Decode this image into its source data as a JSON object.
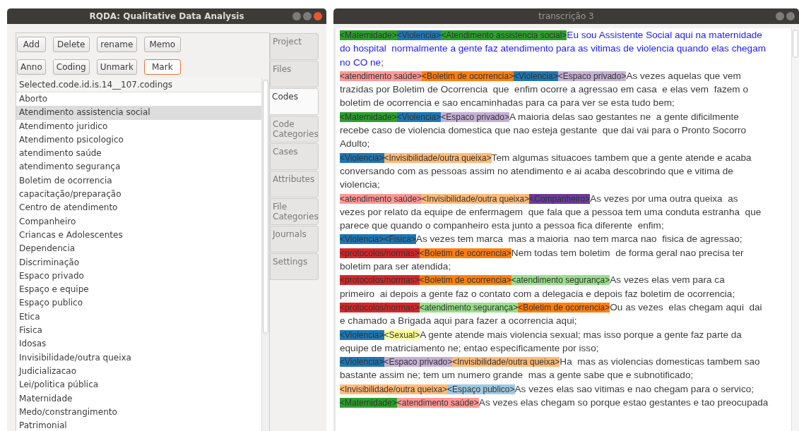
{
  "left_window": {
    "title": "RQDA: Qualitative Data Analysis",
    "buttons": [
      {
        "label": "Add",
        "focused": false
      },
      {
        "label": "Delete",
        "focused": false
      },
      {
        "label": "rename",
        "focused": false
      },
      {
        "label": "Memo",
        "focused": false
      },
      {
        "label": "Anno",
        "focused": false
      },
      {
        "label": "Coding",
        "focused": false
      },
      {
        "label": "Unmark",
        "focused": false
      },
      {
        "label": "Mark",
        "focused": true
      }
    ],
    "list": {
      "header": "Selected.code.id.is.14__107.codings",
      "items": [
        {
          "label": "Aborto",
          "selected": false
        },
        {
          "label": "Atendimento assistencia social",
          "selected": true
        },
        {
          "label": "Atendimento juridico",
          "selected": false
        },
        {
          "label": "Atendimento psicologico",
          "selected": false
        },
        {
          "label": "atendimento saúde",
          "selected": false
        },
        {
          "label": "atendimento segurança",
          "selected": false
        },
        {
          "label": "Boletim de ocorrencia",
          "selected": false
        },
        {
          "label": "capacitação/preparação",
          "selected": false
        },
        {
          "label": "Centro de atendimento",
          "selected": false
        },
        {
          "label": "Companheiro",
          "selected": false
        },
        {
          "label": "Criancas e Adolescentes",
          "selected": false
        },
        {
          "label": "Dependencia",
          "selected": false
        },
        {
          "label": "Discriminação",
          "selected": false
        },
        {
          "label": "Espaco privado",
          "selected": false
        },
        {
          "label": "Espaço e equipe",
          "selected": false
        },
        {
          "label": "Espaço publico",
          "selected": false
        },
        {
          "label": "Etica",
          "selected": false
        },
        {
          "label": "Fisica",
          "selected": false
        },
        {
          "label": "Idosas",
          "selected": false
        },
        {
          "label": "Invisibilidade/outra queixa",
          "selected": false
        },
        {
          "label": "Judicializacao",
          "selected": false
        },
        {
          "label": "Lei/politica pública",
          "selected": false
        },
        {
          "label": "Maternidade",
          "selected": false
        },
        {
          "label": "Medo/constrangimento",
          "selected": false
        },
        {
          "label": "Patrimonial",
          "selected": false
        }
      ]
    },
    "tabs": [
      {
        "label": "Project",
        "selected": false
      },
      {
        "label": "Files",
        "selected": false
      },
      {
        "label": "Codes",
        "selected": true
      },
      {
        "label": "Code Categories",
        "selected": false
      },
      {
        "label": "Cases",
        "selected": false
      },
      {
        "label": "Attributes",
        "selected": false
      },
      {
        "label": "File Categories",
        "selected": false
      },
      {
        "label": "Journals",
        "selected": false
      },
      {
        "label": "Settings",
        "selected": false
      }
    ]
  },
  "right_window": {
    "title": "transcrição 3",
    "paragraphs": [
      {
        "codes": [
          {
            "label": "<Maternidade>",
            "color": "#2ca02c"
          },
          {
            "label": "<Violencia>",
            "color": "#1f77b4"
          },
          {
            "label": "<Atendimento assistencia social>",
            "color": "#2ca02c"
          }
        ],
        "lines": [
          "Eu sou Assistente Social aqui na maternidade",
          "do hospital  normalmente a gente faz atendimento para as vitimas de violencia quando elas chegam",
          "no CO ne"
        ],
        "highlighted": true,
        "end": ";"
      },
      {
        "codes": [
          {
            "label": "<atendimento saúde>",
            "color": "#ff9896"
          },
          {
            "label": "<Boletim de ocorrencia>",
            "color": "#ff7f0e"
          },
          {
            "label": "<Violencia>",
            "color": "#1f77b4"
          },
          {
            "label": "<Espaco privado>",
            "color": "#c5b0d5"
          }
        ],
        "lines": [
          "As vezes aquelas que vem",
          "trazidas por Boletim de Ocorrencia  que  enfim ocorre a agressao em casa  e elas vem  fazem o",
          "boletim de ocorrencia e sao encaminhadas para ca para ver se esta tudo bem;"
        ],
        "highlighted": false
      },
      {
        "codes": [
          {
            "label": "<Maternidade>",
            "color": "#2ca02c"
          },
          {
            "label": "<Violencia>",
            "color": "#1f77b4"
          },
          {
            "label": "<Espaco privado>",
            "color": "#c5b0d5"
          }
        ],
        "lines": [
          "A maioria delas sao gestantes ne  a gente dificilmente",
          "recebe caso de violencia domestica que nao esteja gestante  que dai vai para o Pronto Socorro",
          "Adulto;"
        ],
        "highlighted": false
      },
      {
        "codes": [
          {
            "label": "<Violencia>",
            "color": "#1f77b4"
          },
          {
            "label": "<Invisibilidade/outra queixa>",
            "color": "#ffbb78"
          }
        ],
        "lines": [
          "Tem algumas situacoes tambem que a gente atende e acaba",
          "conversando com as pessoas assim no atendimento e ai acaba descobrindo que e vitima de",
          "violencia;"
        ],
        "highlighted": false
      },
      {
        "codes": [
          {
            "label": "<atendimento saúde>",
            "color": "#ff9896"
          },
          {
            "label": "<Invisibilidade/outra queixa>",
            "color": "#ffbb78"
          },
          {
            "label": "<Companheiro>",
            "color": "#6a3d9a"
          }
        ],
        "lines": [
          "As vezes por uma outra queixa  as",
          "vezes por relato da equipe de enfermagem  que fala que a pessoa tem uma conduta estranha  que",
          "parece que quando o companheiro esta junto a pessoa fica diferente  enfim;"
        ],
        "highlighted": false
      },
      {
        "codes": [
          {
            "label": "<Violencia>",
            "color": "#1f77b4"
          },
          {
            "label": "<Fisica>",
            "color": "#1f77b4"
          }
        ],
        "lines": [
          "As vezes tem marca  mas a maioria  nao tem marca nao  fisica de agressao;"
        ],
        "highlighted": false
      },
      {
        "codes": [
          {
            "label": "<protocolos/normas>",
            "color": "#d62728"
          },
          {
            "label": "<Boletim de ocorrencia>",
            "color": "#ff7f0e"
          }
        ],
        "lines": [
          "Nem todas tem boletim  de forma geral nao precisa ter",
          "boletim para ser atendida;"
        ],
        "highlighted": false
      },
      {
        "codes": [
          {
            "label": "<protocolos/normas>",
            "color": "#d62728"
          },
          {
            "label": "<Boletim de ocorrencia>",
            "color": "#ff7f0e"
          },
          {
            "label": "<atendimento segurança>",
            "color": "#98df8a"
          }
        ],
        "lines": [
          "As vezes elas vem para ca",
          "primeiro  ai depois a gente faz o contato com a delegacia e depois faz boletim de ocorrencia;"
        ],
        "highlighted": false
      },
      {
        "codes": [
          {
            "label": "<protocolos/normas>",
            "color": "#d62728"
          },
          {
            "label": "<atendimento segurança>",
            "color": "#98df8a"
          },
          {
            "label": "<Boletim de ocorrencia>",
            "color": "#ff7f0e"
          }
        ],
        "lines": [
          "Ou as vezes  elas chegam aqui  dai",
          "e chamado a Brigada aqui para fazer a ocorrencia aqui;"
        ],
        "highlighted": false
      },
      {
        "codes": [
          {
            "label": "<Violencia>",
            "color": "#1f77b4"
          },
          {
            "label": "<Sexual>",
            "color": "#ffff99"
          }
        ],
        "lines": [
          "A gente atende mais violencia sexual; mas isso porque a gente faz parte da",
          "equipe de matriciamento ne; entao especificamente por isso;"
        ],
        "highlighted": false
      },
      {
        "codes": [
          {
            "label": "<Violencia>",
            "color": "#1f77b4"
          },
          {
            "label": "<Espaco privado>",
            "color": "#c5b0d5"
          },
          {
            "label": "<Invisibilidade/outra queixa>",
            "color": "#ffbb78"
          }
        ],
        "lines": [
          "Ha  mas as violencias domesticas tambem sao",
          "bastante assim ne; tem um numero grande  mas a gente sabe que e subnotificado;"
        ],
        "highlighted": false
      },
      {
        "codes": [
          {
            "label": "<Invisibilidade/outra queixa>",
            "color": "#ffbb78"
          },
          {
            "label": "<Espaço publico>",
            "color": "#9ecae1"
          }
        ],
        "lines": [
          "As vezes elas sao vitimas e nao chegam para o servico;"
        ],
        "highlighted": false
      },
      {
        "codes": [
          {
            "label": "<Maternidade>",
            "color": "#2ca02c"
          },
          {
            "label": "<atendimento saúde>",
            "color": "#ff9896"
          }
        ],
        "lines": [
          "As vezes elas chegam so porque estao gestantes e tao preocupada"
        ],
        "highlighted": false
      }
    ]
  }
}
